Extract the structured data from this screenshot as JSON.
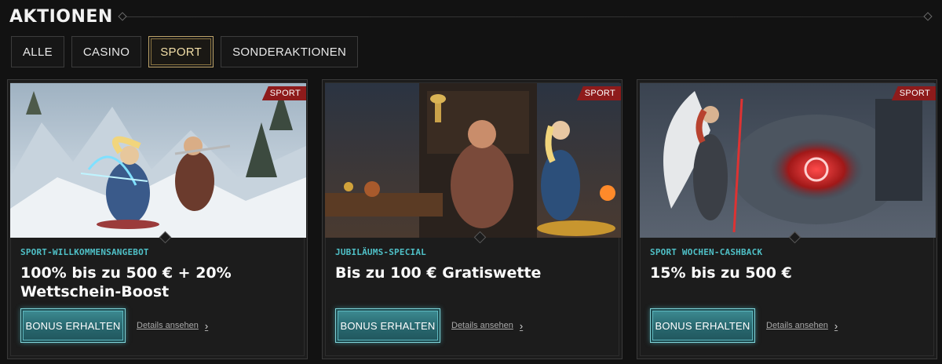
{
  "page": {
    "title": "AKTIONEN"
  },
  "tabs": [
    {
      "label": "ALLE",
      "active": false
    },
    {
      "label": "CASINO",
      "active": false
    },
    {
      "label": "SPORT",
      "active": true
    },
    {
      "label": "SONDERAKTIONEN",
      "active": false
    }
  ],
  "cards": [
    {
      "tag": "SPORT",
      "eyebrow": "Sport-Willkommensangebot",
      "headline": "100% bis zu 500 € + 20% Wettschein-Boost",
      "button": "BONUS ERHALTEN",
      "details": "Details ansehen",
      "image": "viking-snow-archers"
    },
    {
      "tag": "SPORT",
      "eyebrow": "Jubiläums-Special",
      "headline": "Bis zu 100 € Gratiswette",
      "button": "BONUS ERHALTEN",
      "details": "Details ansehen",
      "image": "viking-feast-throne"
    },
    {
      "tag": "SPORT",
      "eyebrow": "Sport Wochen-Cashback",
      "headline": "15% bis zu 500 €",
      "button": "BONUS ERHALTEN",
      "details": "Details ansehen",
      "image": "valkyrie-cashback-portal"
    }
  ],
  "icons": {
    "chevron": "chevron-right-icon",
    "rule_ornament": "diamond-icon"
  },
  "colors": {
    "background": "#121212",
    "accent_gold": "#bfa46a",
    "accent_teal": "#4fc0c7",
    "tag_red": "#8e1b1b"
  }
}
